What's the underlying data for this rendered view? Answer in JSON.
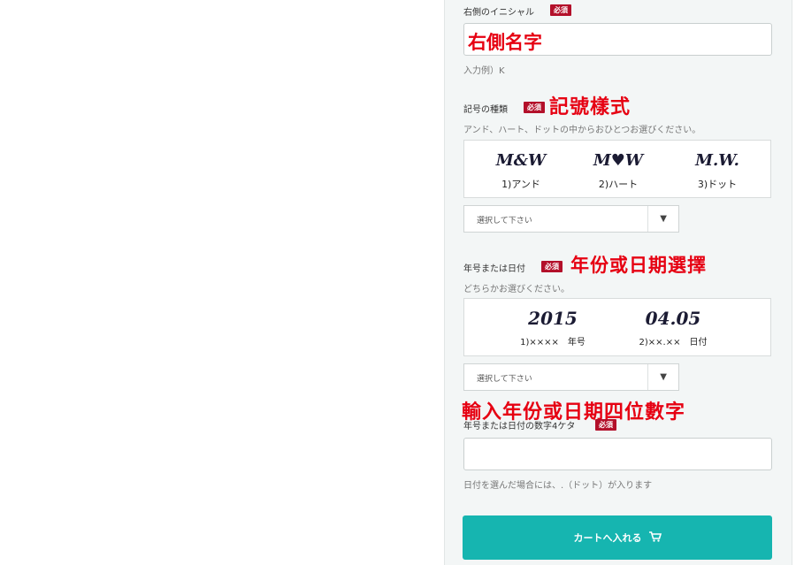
{
  "section1": {
    "label": "右側のイニシャル",
    "badge": "必須",
    "input_value": "右側名字",
    "example": "入力例）K"
  },
  "section2": {
    "label": "記号の種類",
    "badge": "必須",
    "annotation": "記號樣式",
    "hint": "アンド、ハート、ドットの中からおひとつお選びください。",
    "options": [
      {
        "sample": "M&W",
        "caption": "1)アンド"
      },
      {
        "sample": "M♥W",
        "caption": "2)ハート"
      },
      {
        "sample": "M.W.",
        "caption": "3)ドット"
      }
    ],
    "select_value": "選択して下さい"
  },
  "section3": {
    "label": "年号または日付",
    "badge": "必須",
    "annotation": "年份或日期選擇",
    "hint": "どちらかお選びください。",
    "options": [
      {
        "sample": "2015",
        "caption": "1)××××　年号"
      },
      {
        "sample": "04.05",
        "caption": "2)××.××　日付"
      }
    ],
    "select_value": "選択して下さい"
  },
  "section4": {
    "annotation": "輸入年份或日期四位數字",
    "label": "年号または日付の数字4ケタ",
    "badge": "必須",
    "input_value": "",
    "note": "日付を選んだ場合には、.（ドット）が入ります"
  },
  "cart": {
    "label": "カートへ入れる",
    "icon": "cart-icon"
  },
  "colors": {
    "badge": "#b3102a",
    "annotation": "#e60012",
    "cart_button": "#16b5b0"
  }
}
